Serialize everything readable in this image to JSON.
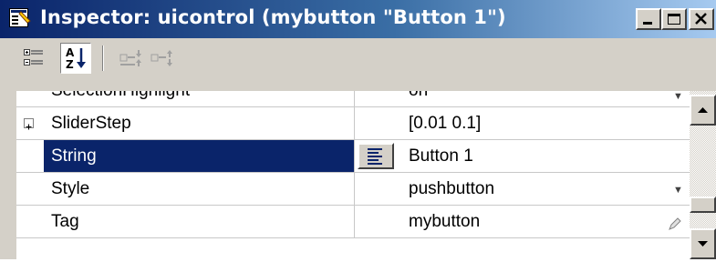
{
  "window": {
    "title": "Inspector:  uicontrol (mybutton \"Button 1\")",
    "icon": "inspector-icon",
    "controls": [
      "minimize-icon",
      "maximize-icon",
      "close-icon"
    ]
  },
  "toolbar": {
    "tools": [
      {
        "name": "categorized-view",
        "icon": "categorized-icon",
        "pressed": false
      },
      {
        "name": "alphabetical-view",
        "icon": "sort-az-icon",
        "label": "A Z",
        "pressed": true
      },
      {
        "name": "expand-all",
        "icon": "expand-all-icon",
        "pressed": false
      },
      {
        "name": "collapse-all",
        "icon": "collapse-all-icon",
        "pressed": false
      }
    ]
  },
  "properties": {
    "rows": [
      {
        "name": "SelectionHighlight",
        "value": "on",
        "partial": "top"
      },
      {
        "name": "SliderStep",
        "value": "[0.01 0.1]",
        "expandable": true,
        "expand_symbol": "+"
      },
      {
        "name": "String",
        "value": "Button 1",
        "selected": true,
        "edit_icon": "text-edit-icon"
      },
      {
        "name": "Style",
        "value": "pushbutton",
        "dropdown": true
      },
      {
        "name": "Tag",
        "value": "mybutton",
        "partial": "bottom",
        "edit_icon": "pencil-icon"
      }
    ]
  },
  "colors": {
    "selection": "#0a246a",
    "titlebar_start": "#0a246a",
    "titlebar_end": "#a6caf0",
    "face": "#d4d0c8"
  }
}
